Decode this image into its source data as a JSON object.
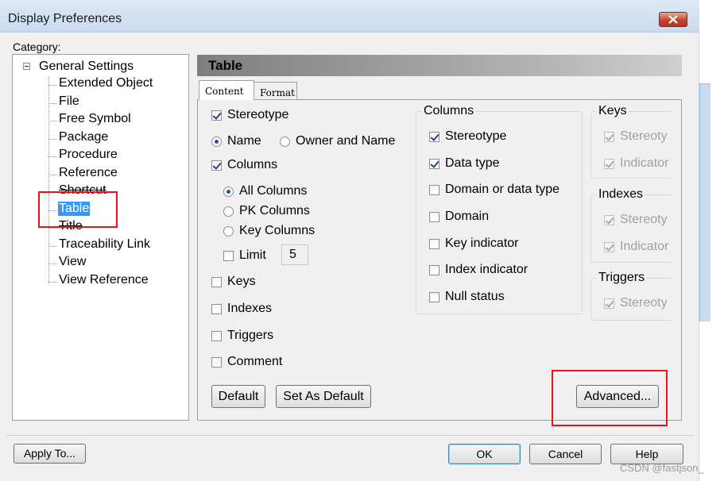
{
  "window": {
    "title": "Display Preferences"
  },
  "category_label": "Category:",
  "tree": {
    "root": "General Settings",
    "items": [
      "Extended Object",
      "File",
      "Free Symbol",
      "Package",
      "Procedure",
      "Reference",
      "Shortcut",
      "Table",
      "Title",
      "Traceability Link",
      "View",
      "View Reference"
    ],
    "selected": "Table"
  },
  "section": {
    "title": "Table"
  },
  "tabs": [
    {
      "label": "Content",
      "active": true
    },
    {
      "label": "Format",
      "active": false
    }
  ],
  "content": {
    "stereotype": {
      "label": "Stereotype",
      "checked": true
    },
    "display_mode": {
      "options": [
        "Name",
        "Owner and Name"
      ],
      "selected": "Name"
    },
    "columns": {
      "label": "Columns",
      "checked": true
    },
    "columns_mode": {
      "options": [
        "All Columns",
        "PK Columns",
        "Key Columns"
      ],
      "selected": "All Columns"
    },
    "limit": {
      "label": "Limit",
      "checked": false,
      "value": "5"
    },
    "keys": {
      "label": "Keys",
      "checked": false
    },
    "indexes": {
      "label": "Indexes",
      "checked": false
    },
    "triggers": {
      "label": "Triggers",
      "checked": false
    },
    "comment": {
      "label": "Comment",
      "checked": false
    }
  },
  "columns_group": {
    "title": "Columns",
    "items": [
      {
        "label": "Stereotype",
        "checked": true
      },
      {
        "label": "Data type",
        "checked": true
      },
      {
        "label": "Domain or data type",
        "checked": false
      },
      {
        "label": "Domain",
        "checked": false
      },
      {
        "label": "Key indicator",
        "checked": false
      },
      {
        "label": "Index indicator",
        "checked": false
      },
      {
        "label": "Null status",
        "checked": false
      }
    ]
  },
  "keys_group": {
    "title": "Keys",
    "items": [
      "Stereoty",
      "Indicator"
    ]
  },
  "indexes_group": {
    "title": "Indexes",
    "items": [
      "Stereoty",
      "Indicator"
    ]
  },
  "triggers_group": {
    "title": "Triggers",
    "items": [
      "Stereoty"
    ]
  },
  "buttons": {
    "default": "Default",
    "set_as_default": "Set As Default",
    "advanced": "Advanced...",
    "apply_to": "Apply To...",
    "ok": "OK",
    "cancel": "Cancel",
    "help": "Help"
  },
  "watermark": "CSDN @fastjson_",
  "colors": {
    "selection": "#3399ff",
    "highlight_box": "#e8141b",
    "close_button": "#c7432a"
  }
}
